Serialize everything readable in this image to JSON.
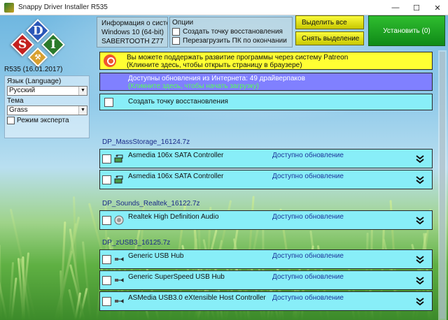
{
  "window": {
    "title": "Snappy Driver Installer R535",
    "minimize": "—",
    "maximize": "☐",
    "close": "✕"
  },
  "logo": {
    "letters": [
      "S",
      "D",
      "I"
    ]
  },
  "version": "R535 (16.01.2017)",
  "settings": {
    "language_label": "Язык (Language)",
    "language_value": "Русский",
    "theme_label": "Тема",
    "theme_value": "Grass",
    "expert_label": "Режим эксперта"
  },
  "sysinfo": {
    "line1": "Информация о систем",
    "line2": "Windows 10 (64-bit)",
    "line3": "SABERTOOTH Z77"
  },
  "options": {
    "title": "Опции",
    "restore_point": "Создать точку восстановления",
    "reboot": "Перезагрузить ПК по окончании"
  },
  "buttons": {
    "select_all": "Выделить все",
    "deselect": "Снять выделение",
    "install": "Установить (0)"
  },
  "notices": {
    "patreon_line1": "Вы можете поддержать развитие программы через систему Patreon",
    "patreon_line2": "(Кликните здесь, чтобы открыть страницу в браузере)",
    "updates_line1": "Доступны обновления из Интернета: 49 драйверпаков",
    "updates_line2": "(Кликните здесь, чтобы начать загрузку)",
    "restore_point": "Создать точку восстановления"
  },
  "groups": [
    {
      "name": "DP_MassStorage_16124.7z",
      "drivers": [
        {
          "name": "Asmedia 106x SATA Controller",
          "status": "Доступно обновление",
          "icon": "storage-controller-icon"
        },
        {
          "name": "Asmedia 106x SATA Controller",
          "status": "Доступно обновление",
          "icon": "storage-controller-icon"
        }
      ]
    },
    {
      "name": "DP_Sounds_Realtek_16122.7z",
      "drivers": [
        {
          "name": "Realtek High Definition Audio",
          "status": "Доступно обновление",
          "icon": "speaker-icon"
        }
      ]
    },
    {
      "name": "DP_zUSB3_16125.7z",
      "drivers": [
        {
          "name": "Generic USB Hub",
          "status": "Доступно обновление",
          "icon": "usb-icon"
        },
        {
          "name": "Generic SuperSpeed USB Hub",
          "status": "Доступно обновление",
          "icon": "usb-icon"
        },
        {
          "name": "ASMedia USB3.0 eXtensible Host Controller",
          "status": "Доступно обновление",
          "icon": "usb-icon"
        }
      ]
    }
  ],
  "colors": {
    "accent_yellow": "#ffff33",
    "update_banner": "#8080ff",
    "driver_row": "#88eef8",
    "install_green": "#1aa31f",
    "status_text": "#1a3399"
  }
}
